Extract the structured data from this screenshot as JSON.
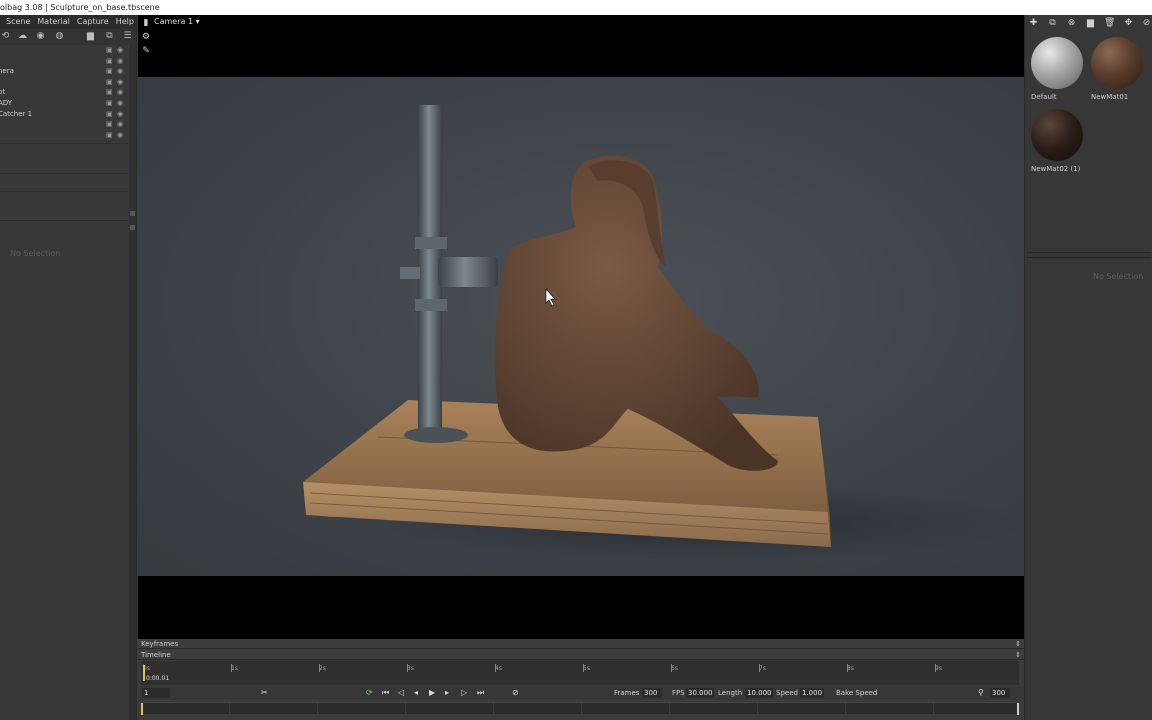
{
  "window_title": "olbag 3.08 | Sculpture_on_base.tbscene",
  "menu": [
    "Scene",
    "Material",
    "Capture",
    "Help"
  ],
  "outliner": [
    {
      "name": ""
    },
    {
      "name": ""
    },
    {
      "name": "nera"
    },
    {
      "name": ""
    },
    {
      "name": "pt"
    },
    {
      "name": "ADY"
    },
    {
      "name": "Catcher 1"
    },
    {
      "name": ""
    },
    {
      "name": ""
    }
  ],
  "left_no_selection": "No Selection",
  "viewport": {
    "camera_label": "Camera 1",
    "background": "#3f444a"
  },
  "materials": [
    {
      "label": "Default",
      "color": "#9a9a9a"
    },
    {
      "label": "NewMat01",
      "color": "#5a3d2c"
    },
    {
      "label": "NewMat02 (1)",
      "color": "#2a1c16"
    }
  ],
  "right_no_selection": "No Selection",
  "timeline": {
    "keyframes_label": "Keyframes",
    "timeline_label": "Timeline",
    "ticks": [
      "0s",
      "1s",
      "2s",
      "3s",
      "4s",
      "5s",
      "6s",
      "7s",
      "8s",
      "9s"
    ],
    "current_time": "0:00.01",
    "frame": "1",
    "frames_label": "Frames",
    "frames_value": "300",
    "fps_label": "FPS",
    "fps_value": "30.000",
    "length_label": "Length",
    "length_value": "10.000",
    "speed_label": "Speed",
    "speed_value": "1.000",
    "bake_speed_label": "Bake Speed",
    "end_frame": "300"
  }
}
